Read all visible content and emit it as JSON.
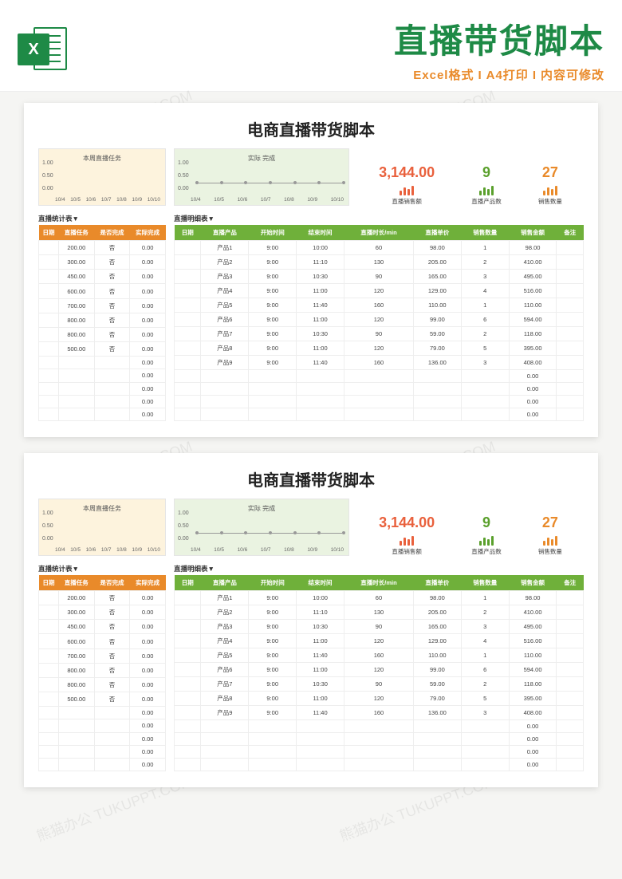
{
  "header": {
    "icon_letter": "X",
    "title": "直播带货脚本",
    "sub1": "Excel格式",
    "sub2": "A4打印",
    "sub3": "内容可修改"
  },
  "chart_data": [
    {
      "type": "line",
      "title": "本周直播任务",
      "yticks": [
        "1.00",
        "0.50",
        "0.00"
      ],
      "categories": [
        "10/4",
        "10/5",
        "10/6",
        "10/7",
        "10/8",
        "10/9",
        "10/10"
      ],
      "values": [
        0,
        0,
        0,
        0,
        0,
        0,
        0
      ]
    },
    {
      "type": "line",
      "title": "实际 完成",
      "yticks": [
        "1.00",
        "0.50",
        "0.00"
      ],
      "categories": [
        "10/4",
        "10/5",
        "10/6",
        "10/7",
        "10/8",
        "10/9",
        "10/10"
      ],
      "values": [
        0,
        0,
        0,
        0,
        0,
        0,
        0
      ]
    }
  ],
  "stats": [
    {
      "value": "3,144.00",
      "label": "直播销售额",
      "color": "red",
      "icon": "red"
    },
    {
      "value": "9",
      "label": "直播产品数",
      "color": "green",
      "icon": "green"
    },
    {
      "value": "27",
      "label": "销售数量",
      "color": "orange",
      "icon": "orange"
    }
  ],
  "page_title": "电商直播带货脚本",
  "section_left": "直播统计表▼",
  "section_right": "直播明细表▼",
  "left_headers": [
    "日期",
    "直播任务",
    "是否完成",
    "实际完成"
  ],
  "left_rows": [
    [
      "",
      "200.00",
      "否",
      "0.00"
    ],
    [
      "",
      "300.00",
      "否",
      "0.00"
    ],
    [
      "",
      "450.00",
      "否",
      "0.00"
    ],
    [
      "",
      "600.00",
      "否",
      "0.00"
    ],
    [
      "",
      "700.00",
      "否",
      "0.00"
    ],
    [
      "",
      "800.00",
      "否",
      "0.00"
    ],
    [
      "",
      "800.00",
      "否",
      "0.00"
    ],
    [
      "",
      "500.00",
      "否",
      "0.00"
    ],
    [
      "",
      "",
      "",
      "0.00"
    ],
    [
      "",
      "",
      "",
      "0.00"
    ],
    [
      "",
      "",
      "",
      "0.00"
    ],
    [
      "",
      "",
      "",
      "0.00"
    ],
    [
      "",
      "",
      "",
      "0.00"
    ]
  ],
  "right_headers": [
    "日期",
    "直播产品",
    "开始时间",
    "结束时间",
    "直播时长/min",
    "直播单价",
    "销售数量",
    "销售金额",
    "备注"
  ],
  "right_rows": [
    [
      "",
      "产品1",
      "9:00",
      "10:00",
      "60",
      "98.00",
      "1",
      "98.00",
      ""
    ],
    [
      "",
      "产品2",
      "9:00",
      "11:10",
      "130",
      "205.00",
      "2",
      "410.00",
      ""
    ],
    [
      "",
      "产品3",
      "9:00",
      "10:30",
      "90",
      "165.00",
      "3",
      "495.00",
      ""
    ],
    [
      "",
      "产品4",
      "9:00",
      "11:00",
      "120",
      "129.00",
      "4",
      "516.00",
      ""
    ],
    [
      "",
      "产品5",
      "9:00",
      "11:40",
      "160",
      "110.00",
      "1",
      "110.00",
      ""
    ],
    [
      "",
      "产品6",
      "9:00",
      "11:00",
      "120",
      "99.00",
      "6",
      "594.00",
      ""
    ],
    [
      "",
      "产品7",
      "9:00",
      "10:30",
      "90",
      "59.00",
      "2",
      "118.00",
      ""
    ],
    [
      "",
      "产品8",
      "9:00",
      "11:00",
      "120",
      "79.00",
      "5",
      "395.00",
      ""
    ],
    [
      "",
      "产品9",
      "9:00",
      "11:40",
      "160",
      "136.00",
      "3",
      "408.00",
      ""
    ],
    [
      "",
      "",
      "",
      "",
      "",
      "",
      "",
      "0.00",
      ""
    ],
    [
      "",
      "",
      "",
      "",
      "",
      "",
      "",
      "0.00",
      ""
    ],
    [
      "",
      "",
      "",
      "",
      "",
      "",
      "",
      "0.00",
      ""
    ],
    [
      "",
      "",
      "",
      "",
      "",
      "",
      "",
      "0.00",
      ""
    ]
  ],
  "watermark": "熊猫办公 TUKUPPT.COM"
}
